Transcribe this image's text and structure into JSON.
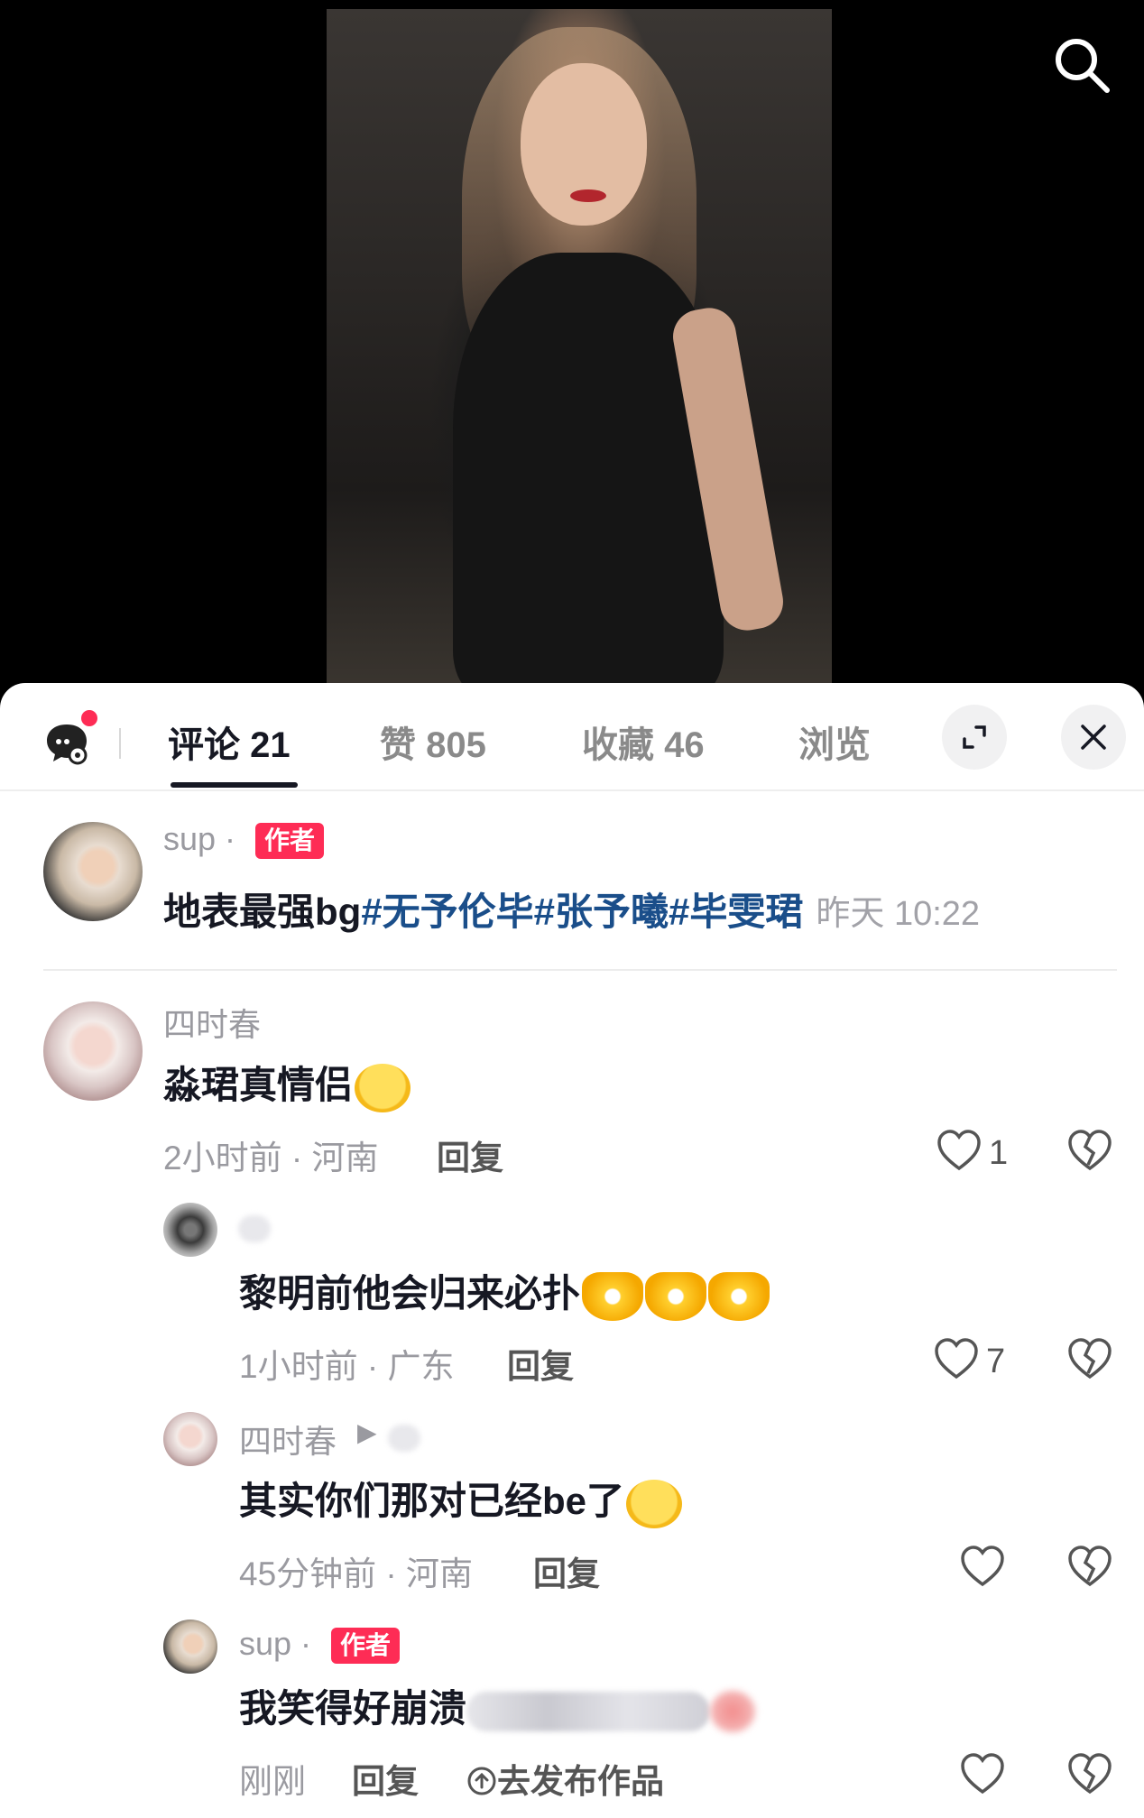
{
  "tabs": {
    "comments_label": "评论",
    "comments_count": "21",
    "likes_label": "赞",
    "likes_count": "805",
    "favorites_label": "收藏",
    "favorites_count": "46",
    "views_label": "浏览"
  },
  "author_post": {
    "username": "sup",
    "badge": "作者",
    "text_prefix": "地表最强bg",
    "hashtags": [
      "#无予伦毕",
      "#张予曦",
      "#毕雯珺"
    ],
    "timestamp": "昨天 10:22"
  },
  "comments": [
    {
      "username": "四时春",
      "text": "淼珺真情侣",
      "emoji": "tears-of-joy-emoji",
      "meta": "2小时前 · 河南",
      "reply_label": "回复",
      "likes": "1"
    }
  ],
  "replies": [
    {
      "username": "",
      "text": "黎明前他会归来必扑",
      "emojis": [
        "heart-hands-emoji",
        "heart-hands-emoji",
        "heart-hands-emoji"
      ],
      "meta": "1小时前 · 广东",
      "reply_label": "回复",
      "likes": "7"
    },
    {
      "username": "四时春",
      "reply_arrow": "▶",
      "text": "其实你们那对已经be了",
      "emoji": "tears-of-joy-emoji",
      "meta": "45分钟前 · 河南",
      "reply_label": "回复",
      "likes": ""
    },
    {
      "username": "sup",
      "badge": "作者",
      "text": "我笑得好崩溃",
      "meta": "刚刚",
      "reply_label": "回复",
      "post_link": "去发布作品",
      "likes": ""
    }
  ],
  "colors": {
    "accent_red": "#fe2c55",
    "hashtag_blue": "#1a4e8a",
    "text_dark": "#161823",
    "text_muted": "#9a9aa0"
  }
}
